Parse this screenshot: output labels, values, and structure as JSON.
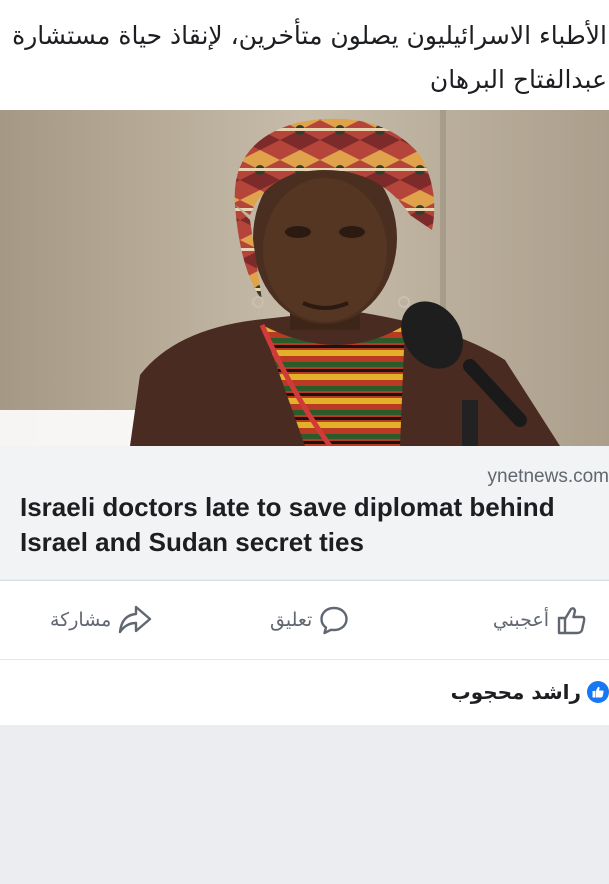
{
  "post": {
    "text_line1": "الأطباء الاسرائيليون يصلون متأخرين، لإنقاذ حياة مستشارة",
    "text_line2": "عبدالفتاح البرهان"
  },
  "link_preview": {
    "domain": "ynetnews.com",
    "headline": "Israeli doctors late to save diplomat behind Israel and Sudan secret ties"
  },
  "actions": {
    "like_label": "أعجبني",
    "comment_label": "تعليق",
    "share_label": "مشاركة"
  },
  "reactions": {
    "reactor_name": "راشد محجوب"
  },
  "colors": {
    "facebook_blue": "#1877f2",
    "action_gray": "#606770",
    "card_bg": "#f2f3f5"
  }
}
